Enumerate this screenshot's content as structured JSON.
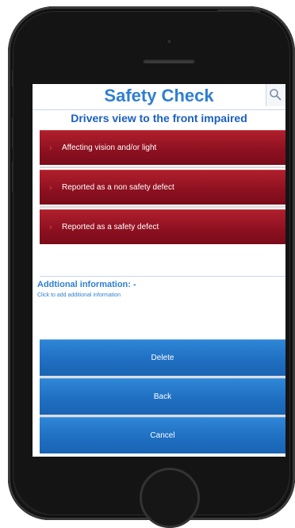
{
  "header": {
    "title": "Safety Check",
    "search_icon": "search-icon"
  },
  "subtitle": "Drivers view to the front impaired",
  "options": [
    {
      "label": "Affecting vision and/or light"
    },
    {
      "label": "Reported as a non safety defect"
    },
    {
      "label": "Reported as a safety defect"
    }
  ],
  "additional": {
    "label": "Addtional information: -",
    "hint": "Click to add additional information"
  },
  "actions": {
    "delete_label": "Delete",
    "back_label": "Back",
    "cancel_label": "Cancel"
  },
  "colors": {
    "accent_blue": "#2f7fd2",
    "option_red": "#8c1020",
    "action_blue": "#1f6fc2"
  }
}
